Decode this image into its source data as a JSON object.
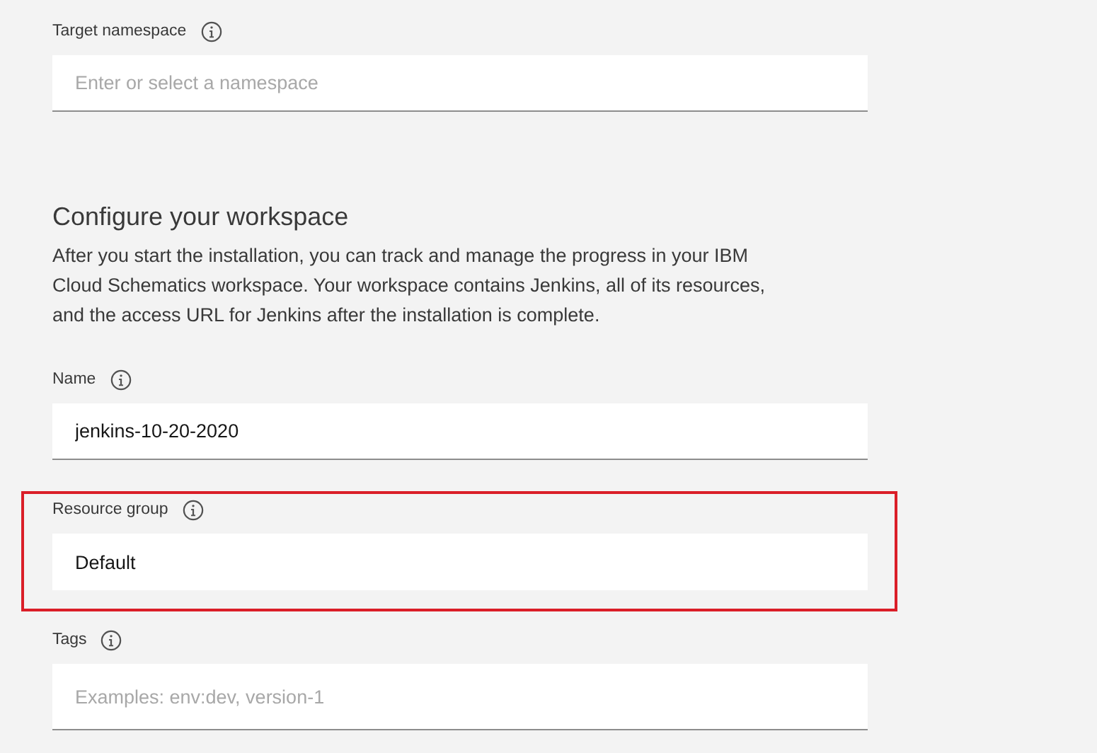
{
  "fields_top": [
    {
      "label": "Target namespace",
      "kind": "text",
      "placeholder": "Enter or select a namespace",
      "highlighted": false
    }
  ],
  "section": {
    "title": "Configure your workspace",
    "description": "After you start the installation, you can track and manage the progress in your IBM Cloud Schematics workspace. Your workspace contains Jenkins, all of its resources, and the access URL for Jenkins after the installation is complete."
  },
  "fields": [
    {
      "label": "Name",
      "kind": "text",
      "value": "jenkins-10-20-2020",
      "highlighted": false
    },
    {
      "label": "Resource group",
      "kind": "select",
      "value": "Default",
      "highlighted": true
    },
    {
      "label": "Tags",
      "kind": "tags",
      "placeholder": "Examples: env:dev, version-1",
      "highlighted": false
    }
  ]
}
